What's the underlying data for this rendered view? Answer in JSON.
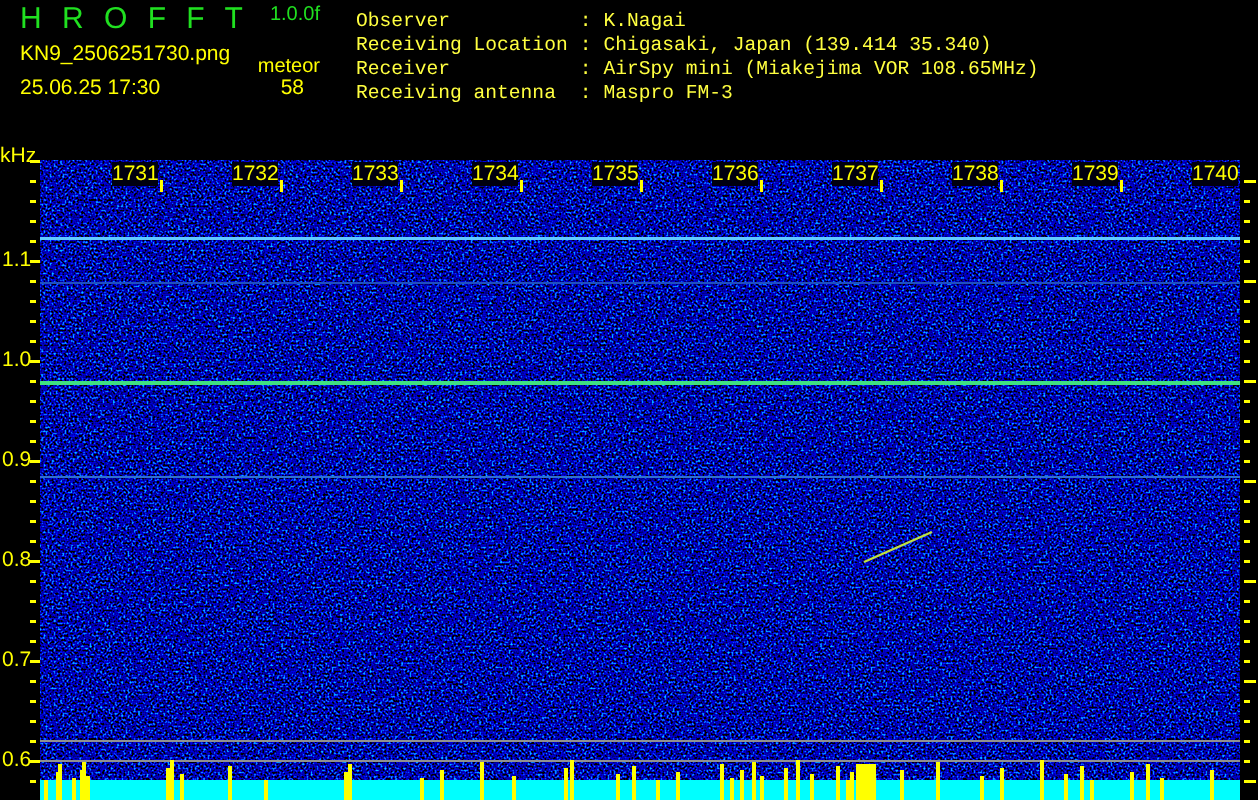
{
  "header": {
    "app_name": "H R O F F T",
    "version": "1.0.0f",
    "filename": "KN9_2506251730.png",
    "count_label": "meteor",
    "datetime": "25.06.25 17:30",
    "count": "58"
  },
  "station": [
    {
      "label": "Observer",
      "separator": ":",
      "value": "K.Nagai"
    },
    {
      "label": "Receiving Location",
      "separator": ":",
      "value": "Chigasaki, Japan (139.414 35.340)"
    },
    {
      "label": "Receiver",
      "separator": ":",
      "value": "AirSpy mini (Miakejima VOR 108.65MHz)"
    },
    {
      "label": "Receiving antenna",
      "separator": ":",
      "value": "Maspro FM-3"
    }
  ],
  "spectrogram": {
    "unit": "kHz",
    "y_ticks": [
      "1.1",
      "1.0",
      "0.9",
      "0.8",
      "0.7",
      "0.6"
    ],
    "time_labels": [
      "1731",
      "1732",
      "1733",
      "1734",
      "1735",
      "1736",
      "1737",
      "1738",
      "1739",
      "1740"
    ]
  }
}
